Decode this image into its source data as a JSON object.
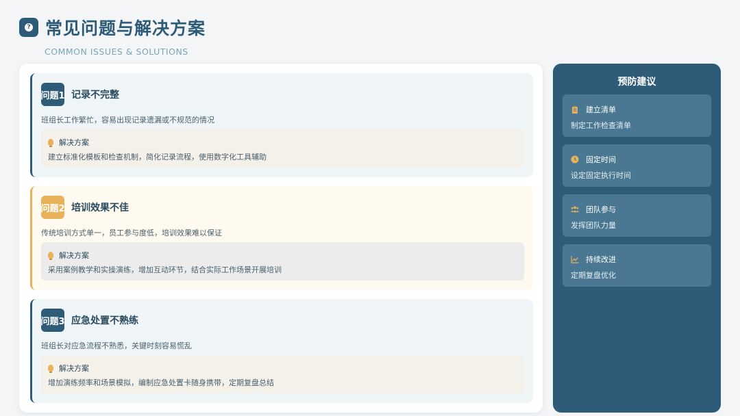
{
  "header": {
    "title": "常见问题与解决方案",
    "subtitle": "COMMON ISSUES & SOLUTIONS",
    "icon": "question-icon"
  },
  "issues": [
    {
      "badge": "问题1",
      "title": "记录不完整",
      "description": "班组长工作繁忙，容易出现记录遗漏或不规范的情况",
      "solution_label": "解决方案",
      "solution_text": "建立标准化模板和检查机制，简化记录流程，使用数字化工具辅助"
    },
    {
      "badge": "问题2",
      "title": "培训效果不佳",
      "description": "传统培训方式单一，员工参与度低，培训效果难以保证",
      "solution_label": "解决方案",
      "solution_text": "采用案例教学和实操演练，增加互动环节，结合实际工作场景开展培训"
    },
    {
      "badge": "问题3",
      "title": "应急处置不熟练",
      "description": "班组长对应急流程不熟悉，关键时刻容易慌乱",
      "solution_label": "解决方案",
      "solution_text": "增加演练频率和场景模拟，编制应急处置卡随身携带，定期复盘总结"
    }
  ],
  "sidebar": {
    "title": "预防建议",
    "tips": [
      {
        "icon": "clipboard-icon",
        "label": "建立清单",
        "text": "制定工作检查清单"
      },
      {
        "icon": "clock-icon",
        "label": "固定时间",
        "text": "设定固定执行时间"
      },
      {
        "icon": "users-icon",
        "label": "团队参与",
        "text": "发挥团队力量"
      },
      {
        "icon": "chart-line-icon",
        "label": "持续改进",
        "text": "定期复盘优化"
      }
    ]
  },
  "colors": {
    "primary": "#2e5c78",
    "accent": "#e8b25a",
    "sidebar_card": "#4a7892"
  }
}
